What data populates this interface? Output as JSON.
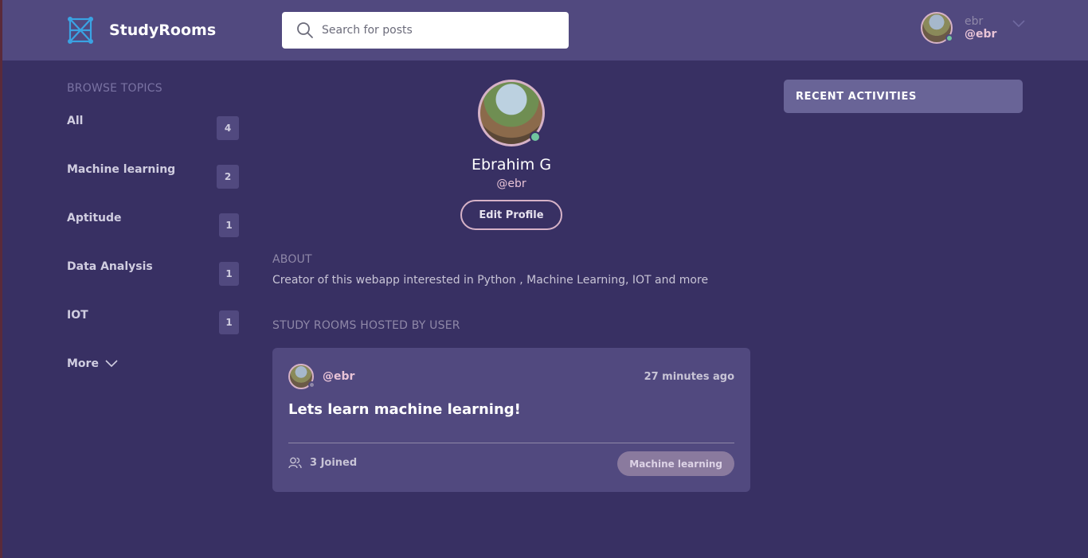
{
  "app": {
    "name": "StudyRooms"
  },
  "search": {
    "placeholder": "Search for posts"
  },
  "current_user": {
    "name": "ebr",
    "handle": "@ebr"
  },
  "sidebar": {
    "heading": "BROWSE TOPICS",
    "topics": [
      {
        "label": "All",
        "count": "4"
      },
      {
        "label": "Machine learning",
        "count": "2"
      },
      {
        "label": "Aptitude",
        "count": "1"
      },
      {
        "label": "Data Analysis",
        "count": "1"
      },
      {
        "label": "IOT",
        "count": "1"
      }
    ],
    "more_label": "More"
  },
  "profile": {
    "name": "Ebrahim G",
    "handle": "@ebr",
    "edit_label": "Edit Profile",
    "about_heading": "ABOUT",
    "about_text": "Creator of this webapp interested in Python , Machine Learning, IOT and more"
  },
  "rooms": {
    "heading": "STUDY ROOMS HOSTED BY USER",
    "items": [
      {
        "host": "@ebr",
        "time": "27 minutes ago",
        "title": "Lets learn machine learning!",
        "joined": "3 Joined",
        "topic": "Machine learning"
      }
    ]
  },
  "activities": {
    "title": "RECENT ACTIVITIES"
  },
  "colors": {
    "background": "#383063",
    "header": "#51497f",
    "accent_pink": "#e8c3d6",
    "online_green": "#71c6a0",
    "logo_blue": "#3aa3e3"
  }
}
